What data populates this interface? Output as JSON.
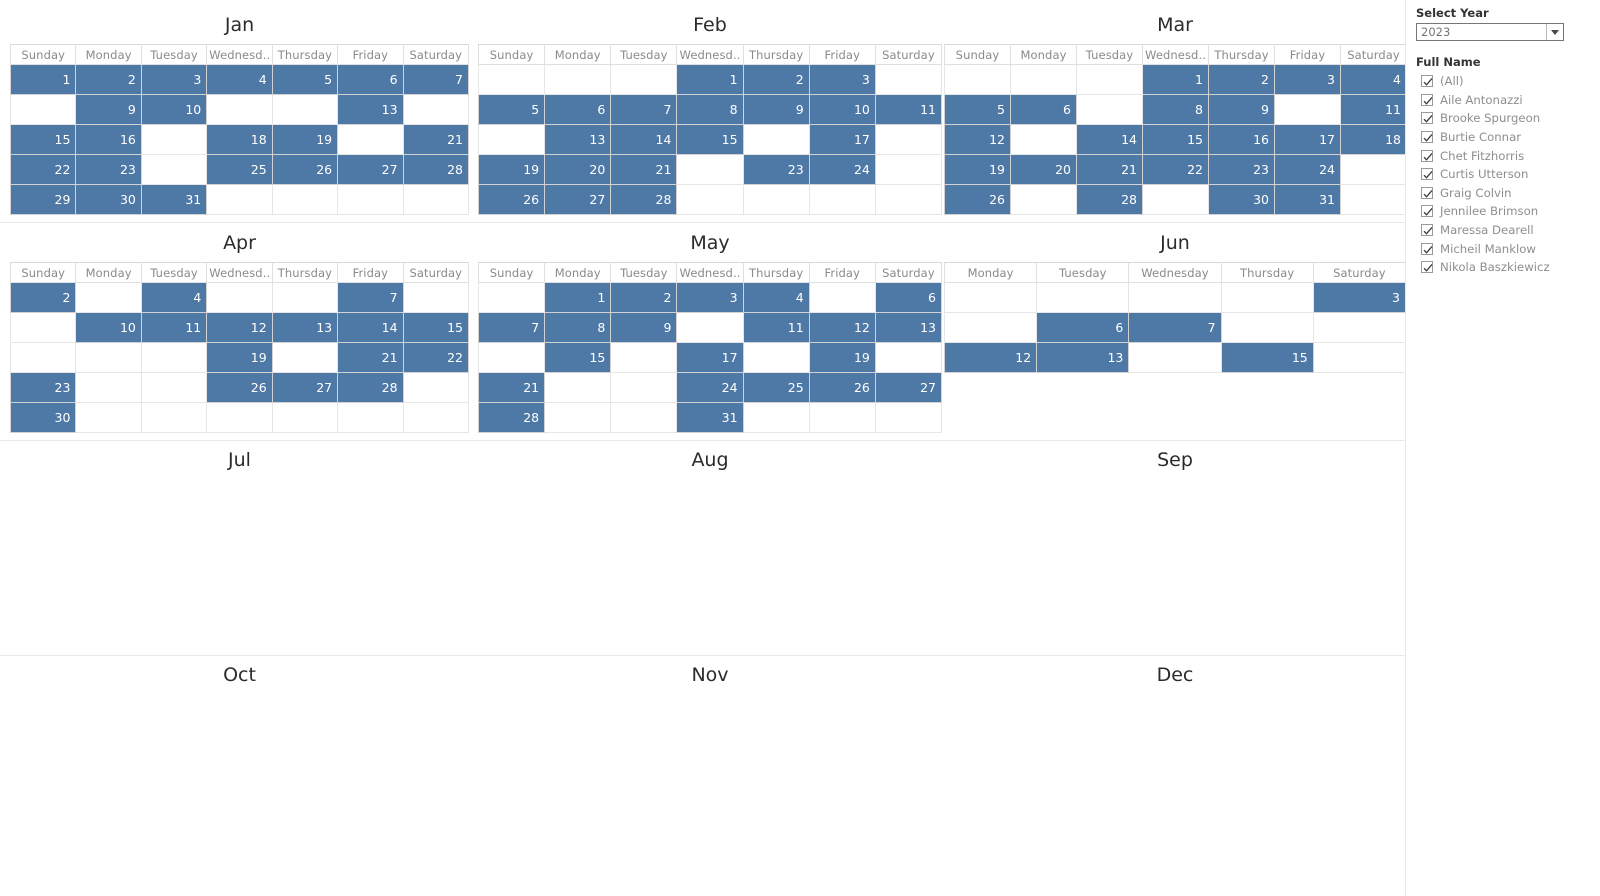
{
  "filters": {
    "year_label": "Select Year",
    "year_value": "2023",
    "year_options": [
      "2023"
    ],
    "dropdown_icon": "chevron-down-icon",
    "name_label": "Full Name",
    "names": [
      "(All)",
      "Aile Antonazzi",
      "Brooke Spurgeon",
      "Burtie Connar",
      "Chet Fitzhorris",
      "Curtis Utterson",
      "Graig Colvin",
      "Jennilee Brimson",
      "Maressa Dearell",
      "Micheil Manklow",
      "Nikola Baszkiewicz"
    ]
  },
  "colors": {
    "mark_blue": "#4e79a7",
    "grid_line": "#e6e6e6",
    "header_text": "#8a8a8a",
    "title_text": "#2b2b2b"
  },
  "chart_data": {
    "type": "heatmap",
    "title": "",
    "xlabel": "",
    "ylabel": "",
    "description": "Calendar heatmap of days marked per month for year 2023; filled cells are highlighted blue",
    "months": [
      {
        "name": "Jan",
        "weekday_headers": [
          "Sunday",
          "Monday",
          "Tuesday",
          "Wednesd..",
          "Thursday",
          "Friday",
          "Saturday"
        ],
        "weeks": [
          [
            {
              "d": "1",
              "on": true
            },
            {
              "d": "2",
              "on": true
            },
            {
              "d": "3",
              "on": true
            },
            {
              "d": "4",
              "on": true
            },
            {
              "d": "5",
              "on": true
            },
            {
              "d": "6",
              "on": true
            },
            {
              "d": "7",
              "on": true
            }
          ],
          [
            {
              "d": "",
              "on": false
            },
            {
              "d": "9",
              "on": true
            },
            {
              "d": "10",
              "on": true
            },
            {
              "d": "",
              "on": false
            },
            {
              "d": "",
              "on": false
            },
            {
              "d": "13",
              "on": true
            },
            {
              "d": "",
              "on": false
            }
          ],
          [
            {
              "d": "15",
              "on": true
            },
            {
              "d": "16",
              "on": true
            },
            {
              "d": "",
              "on": false
            },
            {
              "d": "18",
              "on": true
            },
            {
              "d": "19",
              "on": true
            },
            {
              "d": "",
              "on": false
            },
            {
              "d": "21",
              "on": true
            }
          ],
          [
            {
              "d": "22",
              "on": true
            },
            {
              "d": "23",
              "on": true
            },
            {
              "d": "",
              "on": false
            },
            {
              "d": "25",
              "on": true
            },
            {
              "d": "26",
              "on": true
            },
            {
              "d": "27",
              "on": true
            },
            {
              "d": "28",
              "on": true
            }
          ],
          [
            {
              "d": "29",
              "on": true
            },
            {
              "d": "30",
              "on": true
            },
            {
              "d": "31",
              "on": true
            },
            {
              "d": "",
              "on": false
            },
            {
              "d": "",
              "on": false
            },
            {
              "d": "",
              "on": false
            },
            {
              "d": "",
              "on": false
            }
          ]
        ]
      },
      {
        "name": "Feb",
        "weekday_headers": [
          "Sunday",
          "Monday",
          "Tuesday",
          "Wednesd..",
          "Thursday",
          "Friday",
          "Saturday"
        ],
        "weeks": [
          [
            {
              "d": "",
              "on": false
            },
            {
              "d": "",
              "on": false
            },
            {
              "d": "",
              "on": false
            },
            {
              "d": "1",
              "on": true
            },
            {
              "d": "2",
              "on": true
            },
            {
              "d": "3",
              "on": true
            },
            {
              "d": "",
              "on": false
            }
          ],
          [
            {
              "d": "5",
              "on": true
            },
            {
              "d": "6",
              "on": true
            },
            {
              "d": "7",
              "on": true
            },
            {
              "d": "8",
              "on": true
            },
            {
              "d": "9",
              "on": true
            },
            {
              "d": "10",
              "on": true
            },
            {
              "d": "11",
              "on": true
            }
          ],
          [
            {
              "d": "",
              "on": false
            },
            {
              "d": "13",
              "on": true
            },
            {
              "d": "14",
              "on": true
            },
            {
              "d": "15",
              "on": true
            },
            {
              "d": "",
              "on": false
            },
            {
              "d": "17",
              "on": true
            },
            {
              "d": "",
              "on": false
            }
          ],
          [
            {
              "d": "19",
              "on": true
            },
            {
              "d": "20",
              "on": true
            },
            {
              "d": "21",
              "on": true
            },
            {
              "d": "",
              "on": false
            },
            {
              "d": "23",
              "on": true
            },
            {
              "d": "24",
              "on": true
            },
            {
              "d": "",
              "on": false
            }
          ],
          [
            {
              "d": "26",
              "on": true
            },
            {
              "d": "27",
              "on": true
            },
            {
              "d": "28",
              "on": true
            },
            {
              "d": "",
              "on": false
            },
            {
              "d": "",
              "on": false
            },
            {
              "d": "",
              "on": false
            },
            {
              "d": "",
              "on": false
            }
          ]
        ]
      },
      {
        "name": "Mar",
        "weekday_headers": [
          "Sunday",
          "Monday",
          "Tuesday",
          "Wednesd..",
          "Thursday",
          "Friday",
          "Saturday"
        ],
        "weeks": [
          [
            {
              "d": "",
              "on": false
            },
            {
              "d": "",
              "on": false
            },
            {
              "d": "",
              "on": false
            },
            {
              "d": "1",
              "on": true
            },
            {
              "d": "2",
              "on": true
            },
            {
              "d": "3",
              "on": true
            },
            {
              "d": "4",
              "on": true
            }
          ],
          [
            {
              "d": "5",
              "on": true
            },
            {
              "d": "6",
              "on": true
            },
            {
              "d": "",
              "on": false
            },
            {
              "d": "8",
              "on": true
            },
            {
              "d": "9",
              "on": true
            },
            {
              "d": "",
              "on": false
            },
            {
              "d": "11",
              "on": true
            }
          ],
          [
            {
              "d": "12",
              "on": true
            },
            {
              "d": "",
              "on": false
            },
            {
              "d": "14",
              "on": true
            },
            {
              "d": "15",
              "on": true
            },
            {
              "d": "16",
              "on": true
            },
            {
              "d": "17",
              "on": true
            },
            {
              "d": "18",
              "on": true
            }
          ],
          [
            {
              "d": "19",
              "on": true
            },
            {
              "d": "20",
              "on": true
            },
            {
              "d": "21",
              "on": true
            },
            {
              "d": "22",
              "on": true
            },
            {
              "d": "23",
              "on": true
            },
            {
              "d": "24",
              "on": true
            },
            {
              "d": "",
              "on": false
            }
          ],
          [
            {
              "d": "26",
              "on": true
            },
            {
              "d": "",
              "on": false
            },
            {
              "d": "28",
              "on": true
            },
            {
              "d": "",
              "on": false
            },
            {
              "d": "30",
              "on": true
            },
            {
              "d": "31",
              "on": true
            },
            {
              "d": "",
              "on": false
            }
          ]
        ]
      },
      {
        "name": "Apr",
        "weekday_headers": [
          "Sunday",
          "Monday",
          "Tuesday",
          "Wednesd..",
          "Thursday",
          "Friday",
          "Saturday"
        ],
        "weeks": [
          [
            {
              "d": "2",
              "on": true
            },
            {
              "d": "",
              "on": false
            },
            {
              "d": "4",
              "on": true
            },
            {
              "d": "",
              "on": false
            },
            {
              "d": "",
              "on": false
            },
            {
              "d": "7",
              "on": true
            },
            {
              "d": "",
              "on": false
            }
          ],
          [
            {
              "d": "",
              "on": false
            },
            {
              "d": "10",
              "on": true
            },
            {
              "d": "11",
              "on": true
            },
            {
              "d": "12",
              "on": true
            },
            {
              "d": "13",
              "on": true
            },
            {
              "d": "14",
              "on": true
            },
            {
              "d": "15",
              "on": true
            }
          ],
          [
            {
              "d": "",
              "on": false
            },
            {
              "d": "",
              "on": false
            },
            {
              "d": "",
              "on": false
            },
            {
              "d": "19",
              "on": true
            },
            {
              "d": "",
              "on": false
            },
            {
              "d": "21",
              "on": true
            },
            {
              "d": "22",
              "on": true
            }
          ],
          [
            {
              "d": "23",
              "on": true
            },
            {
              "d": "",
              "on": false
            },
            {
              "d": "",
              "on": false
            },
            {
              "d": "26",
              "on": true
            },
            {
              "d": "27",
              "on": true
            },
            {
              "d": "28",
              "on": true
            },
            {
              "d": "",
              "on": false
            }
          ],
          [
            {
              "d": "30",
              "on": true
            },
            {
              "d": "",
              "on": false
            },
            {
              "d": "",
              "on": false
            },
            {
              "d": "",
              "on": false
            },
            {
              "d": "",
              "on": false
            },
            {
              "d": "",
              "on": false
            },
            {
              "d": "",
              "on": false
            }
          ]
        ]
      },
      {
        "name": "May",
        "weekday_headers": [
          "Sunday",
          "Monday",
          "Tuesday",
          "Wednesd..",
          "Thursday",
          "Friday",
          "Saturday"
        ],
        "weeks": [
          [
            {
              "d": "",
              "on": false
            },
            {
              "d": "1",
              "on": true
            },
            {
              "d": "2",
              "on": true
            },
            {
              "d": "3",
              "on": true
            },
            {
              "d": "4",
              "on": true
            },
            {
              "d": "",
              "on": false
            },
            {
              "d": "6",
              "on": true
            }
          ],
          [
            {
              "d": "7",
              "on": true
            },
            {
              "d": "8",
              "on": true
            },
            {
              "d": "9",
              "on": true
            },
            {
              "d": "",
              "on": false
            },
            {
              "d": "11",
              "on": true
            },
            {
              "d": "12",
              "on": true
            },
            {
              "d": "13",
              "on": true
            }
          ],
          [
            {
              "d": "",
              "on": false
            },
            {
              "d": "15",
              "on": true
            },
            {
              "d": "",
              "on": false
            },
            {
              "d": "17",
              "on": true
            },
            {
              "d": "",
              "on": false
            },
            {
              "d": "19",
              "on": true
            },
            {
              "d": "",
              "on": false
            }
          ],
          [
            {
              "d": "21",
              "on": true
            },
            {
              "d": "",
              "on": false
            },
            {
              "d": "",
              "on": false
            },
            {
              "d": "24",
              "on": true
            },
            {
              "d": "25",
              "on": true
            },
            {
              "d": "26",
              "on": true
            },
            {
              "d": "27",
              "on": true
            }
          ],
          [
            {
              "d": "28",
              "on": true
            },
            {
              "d": "",
              "on": false
            },
            {
              "d": "",
              "on": false
            },
            {
              "d": "31",
              "on": true
            },
            {
              "d": "",
              "on": false
            },
            {
              "d": "",
              "on": false
            },
            {
              "d": "",
              "on": false
            }
          ]
        ]
      },
      {
        "name": "Jun",
        "weekday_headers": [
          "Monday",
          "Tuesday",
          "Wednesday",
          "Thursday",
          "Saturday"
        ],
        "weeks": [
          [
            {
              "d": "",
              "on": false
            },
            {
              "d": "",
              "on": false
            },
            {
              "d": "",
              "on": false
            },
            {
              "d": "",
              "on": false
            },
            {
              "d": "3",
              "on": true
            }
          ],
          [
            {
              "d": "",
              "on": false
            },
            {
              "d": "6",
              "on": true
            },
            {
              "d": "7",
              "on": true
            },
            {
              "d": "",
              "on": false
            },
            {
              "d": "",
              "on": false
            }
          ],
          [
            {
              "d": "12",
              "on": true
            },
            {
              "d": "13",
              "on": true
            },
            {
              "d": "",
              "on": false
            },
            {
              "d": "15",
              "on": true
            },
            {
              "d": "",
              "on": false
            }
          ]
        ]
      },
      {
        "name": "Jul",
        "weekday_headers": [],
        "weeks": []
      },
      {
        "name": "Aug",
        "weekday_headers": [],
        "weeks": []
      },
      {
        "name": "Sep",
        "weekday_headers": [],
        "weeks": []
      },
      {
        "name": "Oct",
        "weekday_headers": [],
        "weeks": []
      },
      {
        "name": "Nov",
        "weekday_headers": [],
        "weeks": []
      },
      {
        "name": "Dec",
        "weekday_headers": [],
        "weeks": []
      }
    ]
  }
}
